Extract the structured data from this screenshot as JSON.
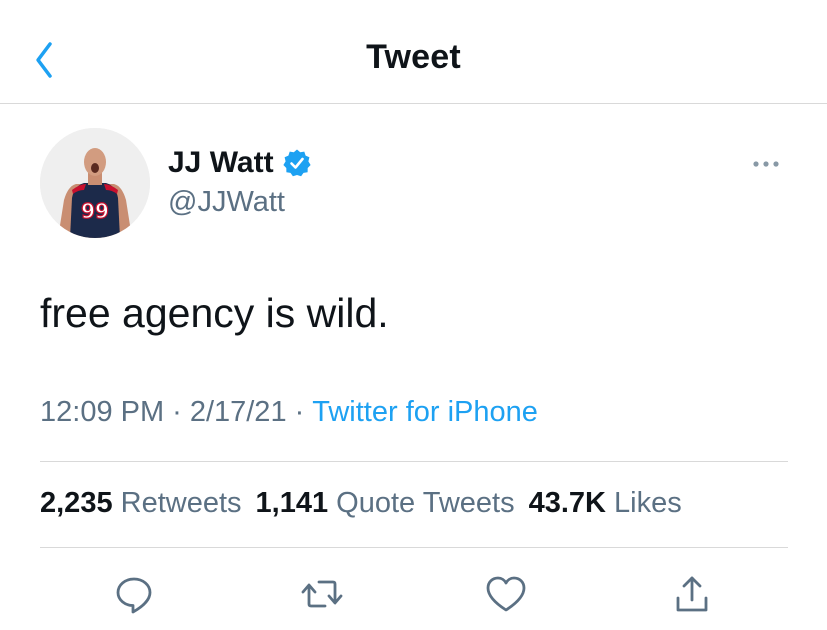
{
  "header": {
    "title": "Tweet",
    "back_icon": "chevron-left-icon",
    "accent_color": "#1da1f2"
  },
  "author": {
    "display_name": "JJ Watt",
    "handle": "@JJWatt",
    "verified": true,
    "avatar_jersey_number": "99"
  },
  "tweet": {
    "text": "free agency is wild.",
    "time": "12:09 PM",
    "date": "2/17/21",
    "separator": "·",
    "source": "Twitter for iPhone"
  },
  "stats": {
    "retweets_count": "2,235",
    "retweets_label": "Retweets",
    "quote_tweets_count": "1,141",
    "quote_tweets_label": "Quote Tweets",
    "likes_count": "43.7K",
    "likes_label": "Likes"
  },
  "actions": [
    {
      "icon": "reply-icon"
    },
    {
      "icon": "retweet-icon"
    },
    {
      "icon": "like-icon"
    },
    {
      "icon": "share-icon"
    }
  ],
  "colors": {
    "text_primary": "#0f1419",
    "text_secondary": "#5b7083",
    "link": "#1da1f2",
    "divider": "#d9d9d9"
  }
}
